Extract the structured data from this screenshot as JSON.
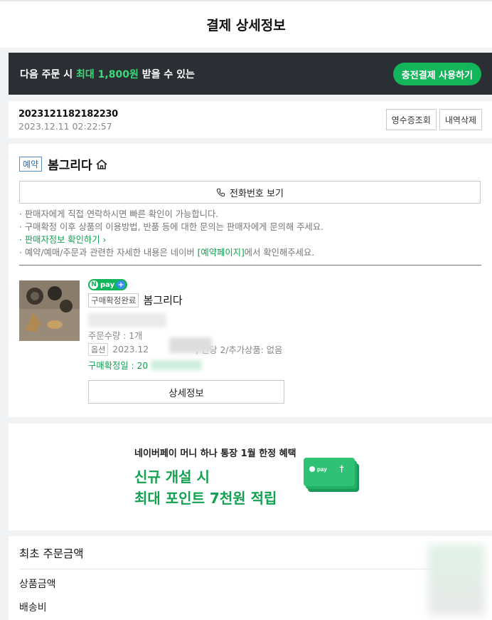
{
  "header": {
    "title": "결제 상세정보"
  },
  "promo": {
    "text_prefix": "다음 주문 시 ",
    "text_highlight": "최대 1,800원",
    "text_suffix": " 받을 수 있는",
    "button": "충전결제 사용하기",
    "highlight_color": "#3bd97a",
    "button_color": "#12b55a"
  },
  "order": {
    "number": "2023121182182230",
    "date": "2023.12.11 02:22:57",
    "receipt_button": "영수증조회",
    "delete_button": "내역삭제"
  },
  "seller": {
    "badge": "예약",
    "name": "봄그리다",
    "phone_button": "전화번호 보기",
    "notes": [
      "판매자에게 직접 연락하시면 빠른 확인이 가능합니다.",
      "구매확정 이후 상품의 이용방법, 반품 등에 대한 문의는 판매자에게 문의해 주세요."
    ],
    "seller_info_link": "판매자정보 확인하기",
    "note4_prefix": "예약/예매/주문과 관련한 자세한 내용은 네이버 ",
    "note4_link": "[예약페이지]",
    "note4_suffix": "에서 확인해주세요."
  },
  "product": {
    "npay_label": "pay",
    "status": "구매확정완료",
    "name": "봄그리다",
    "quantity": "주문수량 : 1개",
    "option_label": "옵션",
    "option_text": "2023.12",
    "option_tail": ", 인당 2/추가상품: 없음",
    "confirm_label": "구매확정일 : 20",
    "detail_button": "상세정보"
  },
  "banner": {
    "subtitle": "네이버페이 머니 하나 통장 1월 한정 혜택",
    "line1": "신규 개설 시",
    "line2": "최대 포인트 7천원 적립",
    "card_text": "pay",
    "accent_color": "#12a150"
  },
  "summary": {
    "title": "최초 주문금액",
    "row1": "상품금액",
    "row2": "배송비"
  }
}
